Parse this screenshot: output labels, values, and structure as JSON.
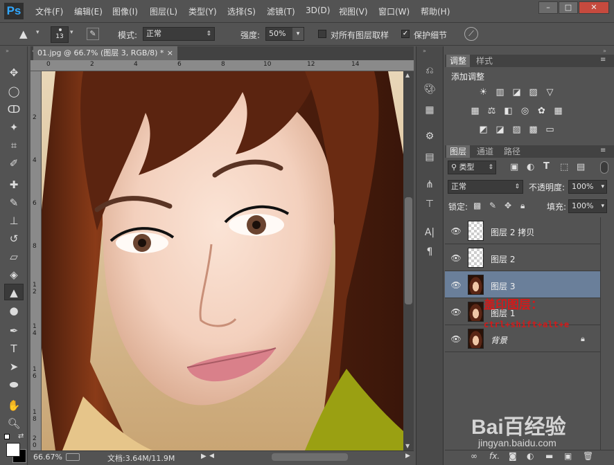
{
  "app": {
    "logo": "Ps"
  },
  "menu": [
    "文件(F)",
    "编辑(E)",
    "图像(I)",
    "图层(L)",
    "类型(Y)",
    "选择(S)",
    "滤镜(T)",
    "3D(D)",
    "视图(V)",
    "窗口(W)",
    "帮助(H)"
  ],
  "window_controls": {
    "minimize": "–",
    "maximize": "□",
    "close": "✕"
  },
  "options": {
    "brush_size": "13",
    "mode_label": "模式:",
    "mode_value": "正常",
    "strength_label": "强度:",
    "strength_value": "50%",
    "sample_all_layers": "对所有图层取样",
    "protect_detail": "保护细节"
  },
  "document": {
    "tab_title": "01.jpg @ 66.7% (图层 3, RGB/8) *",
    "close": "×",
    "ruler_top": [
      "0",
      "2",
      "4",
      "6",
      "8",
      "10",
      "12",
      "14"
    ],
    "ruler_left": [
      "2",
      "4",
      "6",
      "8",
      "1",
      "2",
      "1",
      "4",
      "1",
      "6",
      "1",
      "8",
      "2",
      "0"
    ],
    "zoom": "66.67%",
    "doc_info": "文档:3.64M/11.9M"
  },
  "adjust_panel": {
    "tabs": [
      "调整",
      "样式"
    ],
    "title": "添加调整",
    "row1": [
      "☀",
      "▥",
      "◪",
      "▨",
      "▽"
    ],
    "row2": [
      "▦",
      "⚖",
      "◧",
      "◎",
      "✿",
      "▦"
    ],
    "row3": [
      "◩",
      "◪",
      "▨",
      "▩",
      "▭"
    ]
  },
  "layers_panel": {
    "tabs": [
      "图层",
      "通道",
      "路径"
    ],
    "filter_label": "类型",
    "blend_mode": "正常",
    "opacity_label": "不透明度:",
    "opacity_value": "100%",
    "lock_label": "锁定:",
    "fill_label": "填充:",
    "fill_value": "100%",
    "layers": [
      {
        "name": "图层 2 拷贝",
        "selected": false,
        "thumb": "transparent"
      },
      {
        "name": "图层 2",
        "selected": false,
        "thumb": "transparent"
      },
      {
        "name": "图层 3",
        "selected": true,
        "thumb": "photo"
      },
      {
        "name": "图层 1",
        "selected": false,
        "thumb": "photo"
      },
      {
        "name": "背景",
        "selected": false,
        "thumb": "photo",
        "locked": true
      }
    ],
    "annotation_line1": "盖印图层：",
    "annotation_line2": "ctrl+shift+alt+e"
  },
  "watermark": {
    "brand": "Bai百经验",
    "url": "jingyan.baidu.com"
  },
  "colors": {
    "selected_layer": "#6a7f9a",
    "annotation": "#d21a1a",
    "ps_blue": "#31a8ff"
  }
}
